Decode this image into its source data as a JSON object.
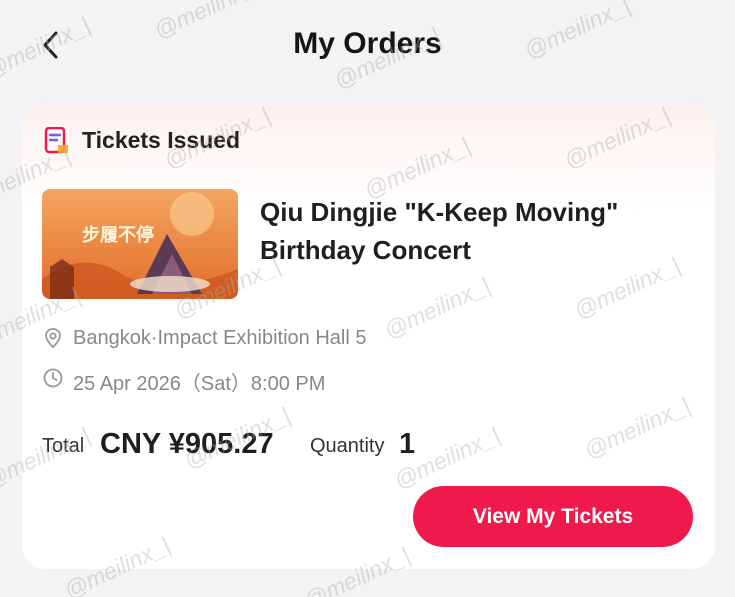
{
  "header": {
    "title": "My Orders"
  },
  "order": {
    "status": "Tickets Issued",
    "event_title": "Qiu Dingjie \"K-Keep Moving\" Birthday Concert",
    "venue": "Bangkok·Impact Exhibition Hall 5",
    "time": "25 Apr 2026（Sat）8:00 PM",
    "total_label": "Total",
    "total_value": "CNY ¥905.27",
    "quantity_label": "Quantity",
    "quantity_value": "1",
    "cta_label": "View My Tickets"
  },
  "poster": {
    "title_text": "步履不停"
  },
  "watermark": {
    "text": "@meilinx_|"
  },
  "colors": {
    "accent": "#f0194b",
    "poster_bg": "#f08a3e"
  }
}
